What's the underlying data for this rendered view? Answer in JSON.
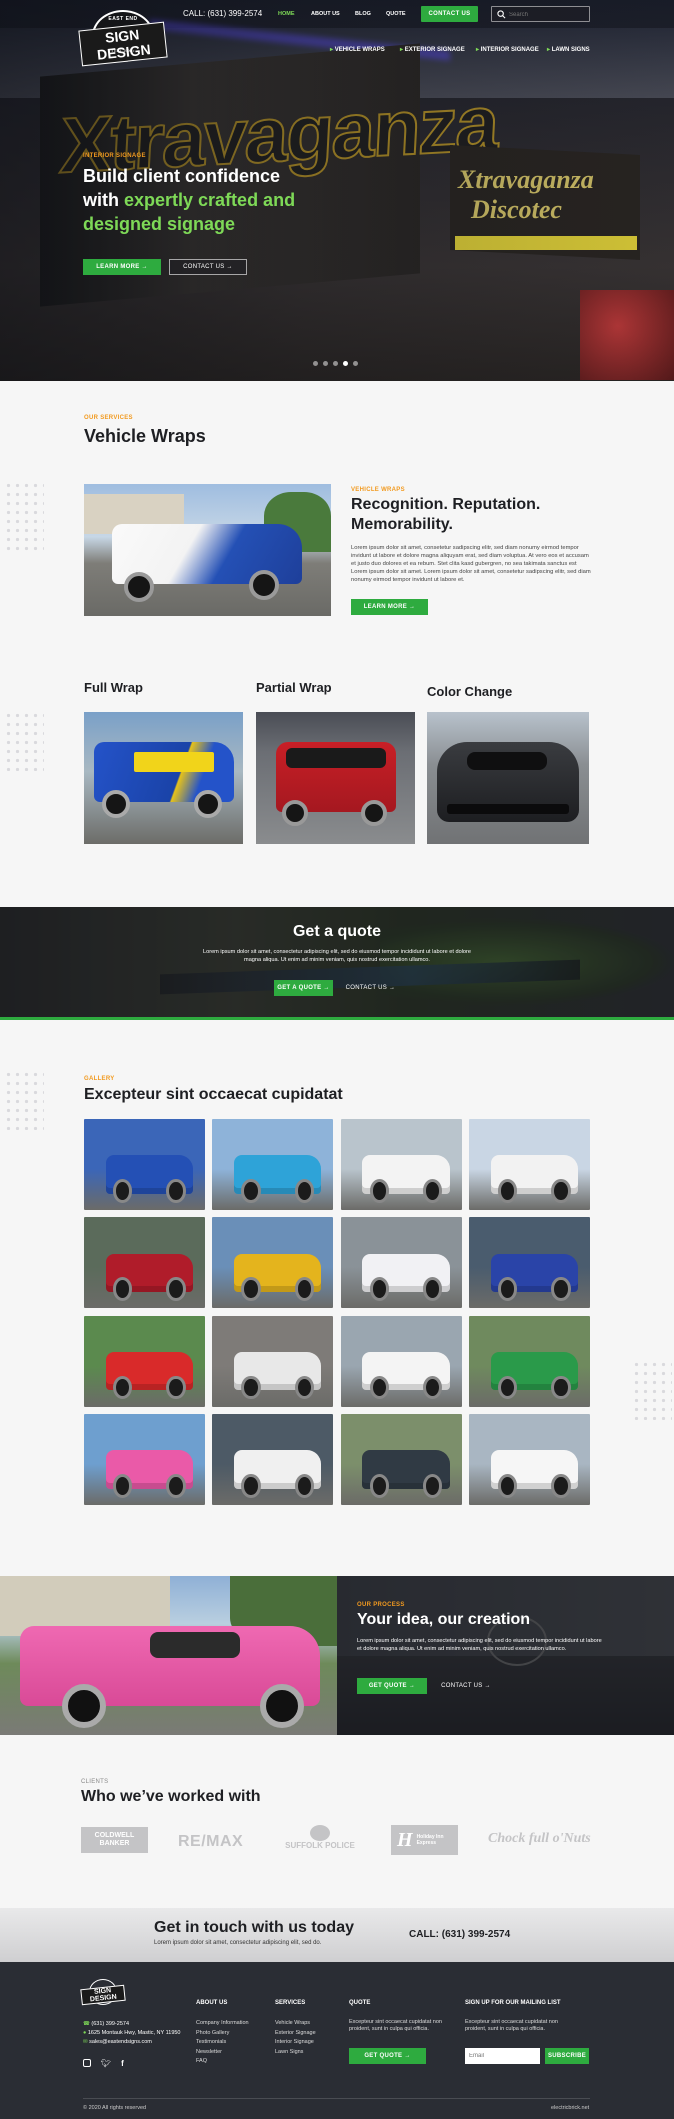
{
  "header": {
    "logo": {
      "top": "EAST END",
      "main": "SIGN DESIGN",
      "bottom": "• EST 1990 •"
    },
    "phone": "CALL: (631) 399-2574",
    "nav": [
      "HOME",
      "ABOUT US",
      "BLOG",
      "QUOTE"
    ],
    "contact_button": "CONTACT US",
    "search_placeholder": "Search",
    "subnav": [
      "VEHICLE WRAPS",
      "EXTERIOR SIGNAGE",
      "INTERIOR SIGNAGE",
      "LAWN SIGNS"
    ]
  },
  "hero": {
    "eyebrow": "INTERIOR SIGNAGE",
    "headline_line1": "Build client confidence",
    "headline_with": "with ",
    "headline_green1": "expertly crafted and",
    "headline_green2": "designed signage",
    "learn_more": "LEARN MORE",
    "contact": "CONTACT US",
    "slider_count": 5,
    "slider_active": 4
  },
  "services": {
    "eyebrow": "OUR SERVICES",
    "title": "Vehicle Wraps",
    "feature": {
      "eyebrow": "VEHICLE WRAPS",
      "title_line1": "Recognition. Reputation.",
      "title_line2": "Memorability.",
      "body1": "Lorem ipsum dolor sit amet, consetetur sadipscing elitr, sed diam nonumy eirmod tempor invidunt ut labore et dolore magna aliquyam erat, sed diam voluptua. At vero eos et accusam et justo duo dolores et ea rebum. Stet clita kasd gubergren, no sea takimata sanctus est Lorem ipsum dolor sit amet. Lorem ipsum dolor sit amet, consetetur sadipscing elitr, sed diam nonumy eirmod tempor invidunt ut labore et.",
      "button": "LEARN MORE"
    },
    "cards": [
      "Full Wrap",
      "Partial Wrap",
      "Color Change"
    ]
  },
  "quote_band": {
    "title": "Get a quote",
    "body": "Lorem ipsum dolor sit amet, consectetur adipiscing elit, sed do eiusmod tempor incididunt ut labore et dolore magna aliqua. Ut enim ad minim veniam, quis nostrud exercitation ullamco.",
    "button": "GET A QUOTE",
    "contact": "CONTACT US"
  },
  "gallery": {
    "eyebrow": "GALLERY",
    "title": "Excepteur sint occaecat cupidatat",
    "tiles": [
      {
        "bg": "#3b66b8",
        "body": "#2450b5"
      },
      {
        "bg": "#8eb3d9",
        "body": "#2ea3d8"
      },
      {
        "bg": "#b9c4cc",
        "body": "#f3f3f3"
      },
      {
        "bg": "#c9d6e4",
        "body": "#f2f2f2"
      },
      {
        "bg": "#5b6b5b",
        "body": "#b01c2a"
      },
      {
        "bg": "#6a8fb8",
        "body": "#e4b41d"
      },
      {
        "bg": "#8a9298",
        "body": "#f1f1f4"
      },
      {
        "bg": "#4a5c6e",
        "body": "#2a44a8"
      },
      {
        "bg": "#5b8a4e",
        "body": "#d92a2a"
      },
      {
        "bg": "#7e7b78",
        "body": "#e8e8e8"
      },
      {
        "bg": "#9aa6b0",
        "body": "#f4f4f4"
      },
      {
        "bg": "#6f8a5e",
        "body": "#2a9a4a"
      },
      {
        "bg": "#6e9fcf",
        "body": "#ea5aa8"
      },
      {
        "bg": "#4d5a66",
        "body": "#f0f0f0"
      },
      {
        "bg": "#7c8f6b",
        "body": "#303a44"
      },
      {
        "bg": "#a9b6c2",
        "body": "#f6f6f6"
      }
    ]
  },
  "process": {
    "eyebrow": "OUR PROCESS",
    "title": "Your idea, our creation",
    "body": "Lorem ipsum dolor sit amet, consectetur adipiscing elit, sed do eiusmod tempor incididunt ut labore et dolore magna aliqua. Ut enim ad minim veniam, quis nostrud exercitation ullamco.",
    "button": "GET QUOTE",
    "contact": "CONTACT US"
  },
  "clients": {
    "eyebrow": "CLIENTS",
    "title": "Who we’ve worked with",
    "logos": [
      "COLDWELL BANKER",
      "RE/MAX",
      "SUFFOLK POLICE",
      "Holiday Inn Express",
      "Chock full o'Nuts"
    ]
  },
  "cta": {
    "title": "Get in touch with us today",
    "body": "Lorem ipsum dolor sit amet, consectetur adipiscing elit, sed do.",
    "phone": "CALL: (631) 399-2574"
  },
  "footer": {
    "phone": "(631) 399-2574",
    "address": "1625 Montauk Hwy, Mastic, NY 11950",
    "email": "sales@eastendsigns.com",
    "about_title": "ABOUT US",
    "about_links": [
      "Company Information",
      "Photo Gallery",
      "Testimonials",
      "Newsletter",
      "FAQ"
    ],
    "services_title": "SERVICES",
    "services_links": [
      "Vehicle Wraps",
      "Exterior Signage",
      "Interior Signage",
      "Lawn Signs"
    ],
    "quote_title": "QUOTE",
    "quote_text": "Excepteur sint occaecat cupidatat non proident, sunt in culpa qui officia.",
    "quote_button": "GET QUOTE",
    "mailing_title": "SIGN UP FOR OUR MAILING LIST",
    "mailing_text": "Excepteur sint occaecat cupidatat non proident, sunt in culpa qui officia.",
    "email_placeholder": "Email",
    "subscribe": "SUBSCRIBE",
    "copyright": "© 2020 All rights reserved",
    "credit": "electricbrick.net"
  },
  "colors": {
    "accent_green": "#2eab3f",
    "highlight_green": "#7ed957",
    "eyebrow_orange": "#f29a1f",
    "dark": "#2a2d34"
  }
}
